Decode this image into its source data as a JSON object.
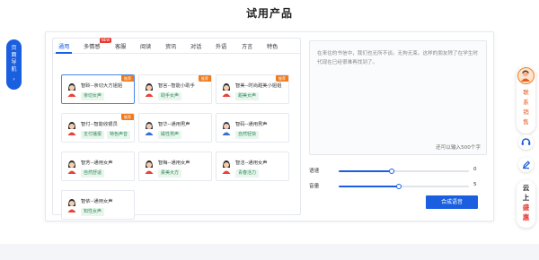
{
  "page": {
    "title": "试用产品"
  },
  "left_nav": {
    "label": "页面导航",
    "chevron": "›"
  },
  "tabs": [
    {
      "label": "通用",
      "active": true
    },
    {
      "label": "多情感",
      "badge": "NEW"
    },
    {
      "label": "客服"
    },
    {
      "label": "阅读"
    },
    {
      "label": "资讯"
    },
    {
      "label": "对话"
    },
    {
      "label": "外语"
    },
    {
      "label": "方言"
    },
    {
      "label": "特色"
    }
  ],
  "voices": [
    {
      "name": "智聆--亲切大方姐姐",
      "tags": [
        "亲切女声"
      ],
      "badge": "推荐",
      "selected": true,
      "avatar": "female-avatar"
    },
    {
      "name": "智言--智能小助手",
      "tags": [
        "助手女声"
      ],
      "badge": "推荐",
      "avatar": "female-avatar"
    },
    {
      "name": "智美--时尚甜美小姐姐",
      "tags": [
        "甜美女声"
      ],
      "badge": "推荐",
      "avatar": "female-avatar"
    },
    {
      "name": "智付--智能收银员",
      "tags": [
        "支付播报",
        "特色声音"
      ],
      "badge": "推荐",
      "avatar": "female-avatar"
    },
    {
      "name": "智华--通用男声",
      "tags": [
        "磁性男声"
      ],
      "avatar": "male-avatar"
    },
    {
      "name": "智码--通用男声",
      "tags": [
        "自然轻快"
      ],
      "avatar": "male-avatar"
    },
    {
      "name": "智芳--通用女声",
      "tags": [
        "自然舒适"
      ],
      "avatar": "female-avatar"
    },
    {
      "name": "智梅--通用女声",
      "tags": [
        "柔美大方"
      ],
      "avatar": "female-avatar"
    },
    {
      "name": "智洁--通用女声",
      "tags": [
        "青春活力"
      ],
      "avatar": "female-avatar"
    },
    {
      "name": "智依--通用女声",
      "tags": [
        "知性女声"
      ],
      "avatar": "female-avatar"
    }
  ],
  "text_panel": {
    "content": "在来往的书信中，我们也无所不谈。无拘无束。这样的朋友除了在学生时代现在已经很难再找到了。",
    "count_label": "还可以输入500个字"
  },
  "controls": {
    "speed": {
      "label": "语速",
      "value": "0",
      "fraction": 0.41
    },
    "volume": {
      "label": "音量",
      "value": "5",
      "fraction": 0.46
    },
    "synth_label": "合成语音"
  },
  "right_widget": {
    "agent_label": "联系销售",
    "cloud_line1": "云上",
    "cloud_line2": "盛惠"
  },
  "colors": {
    "primary": "#1a5fe0",
    "hot": "#f07b1f",
    "tag_bg": "#e9f6ee",
    "tag_text": "#2e8b57",
    "accent_red": "#e8322a"
  }
}
